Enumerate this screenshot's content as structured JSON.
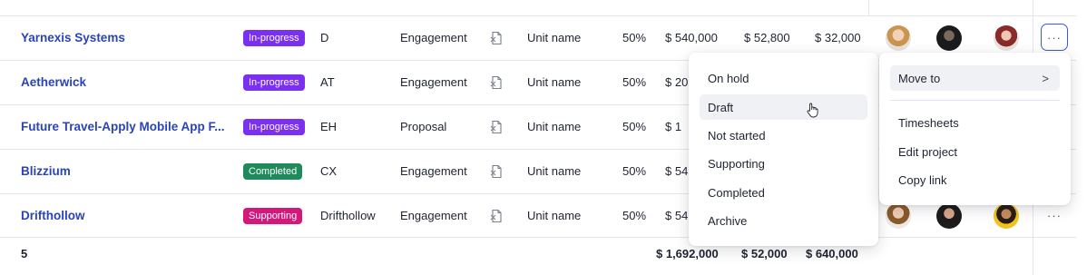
{
  "rows": [
    {
      "name": "Yarnexis Systems",
      "status": "In-progress",
      "status_color": "#7b2ff0",
      "code": "D",
      "type": "Engagement",
      "unit": "Unit name",
      "pct": "50%",
      "amt1": "$ 540,000",
      "amt2": "$ 52,800",
      "amt3": "$ 32,000"
    },
    {
      "name": "Aetherwick",
      "status": "In-progress",
      "status_color": "#7b2ff0",
      "code": "AT",
      "type": "Engagement",
      "unit": "Unit name",
      "pct": "50%",
      "amt1": "$ 20",
      "amt2": "",
      "amt3": ""
    },
    {
      "name": "Future Travel-Apply Mobile App F...",
      "status": "In-progress",
      "status_color": "#7b2ff0",
      "code": "EH",
      "type": "Proposal",
      "unit": "Unit name",
      "pct": "50%",
      "amt1": "$ 1",
      "amt2": "",
      "amt3": ""
    },
    {
      "name": "Blizzium",
      "status": "Completed",
      "status_color": "#1f8a5b",
      "code": "CX",
      "type": "Engagement",
      "unit": "Unit name",
      "pct": "50%",
      "amt1": "$ 54",
      "amt2": "",
      "amt3": ""
    },
    {
      "name": "Drifthollow",
      "status": "Supporting",
      "status_color": "#d4177a",
      "code": "Drifthollow",
      "type": "Engagement",
      "unit": "Unit name",
      "pct": "50%",
      "amt1": "$ 54",
      "amt2": "",
      "amt3": ""
    }
  ],
  "totals": {
    "count": "5",
    "amt1": "$ 1,692,000",
    "amt2": "$ 52,000",
    "amt3": "$ 640,000"
  },
  "more_label": "···",
  "status_menu": {
    "items": [
      {
        "label": "On hold"
      },
      {
        "label": "Draft"
      },
      {
        "label": "Not started"
      },
      {
        "label": "Supporting"
      },
      {
        "label": "Completed"
      },
      {
        "label": "Archive"
      }
    ],
    "hovered": "Draft"
  },
  "actions_menu": {
    "move_to": "Move to",
    "submenu_arrow": ">",
    "items": [
      {
        "label": "Timesheets"
      },
      {
        "label": "Edit project"
      },
      {
        "label": "Copy link"
      }
    ]
  }
}
